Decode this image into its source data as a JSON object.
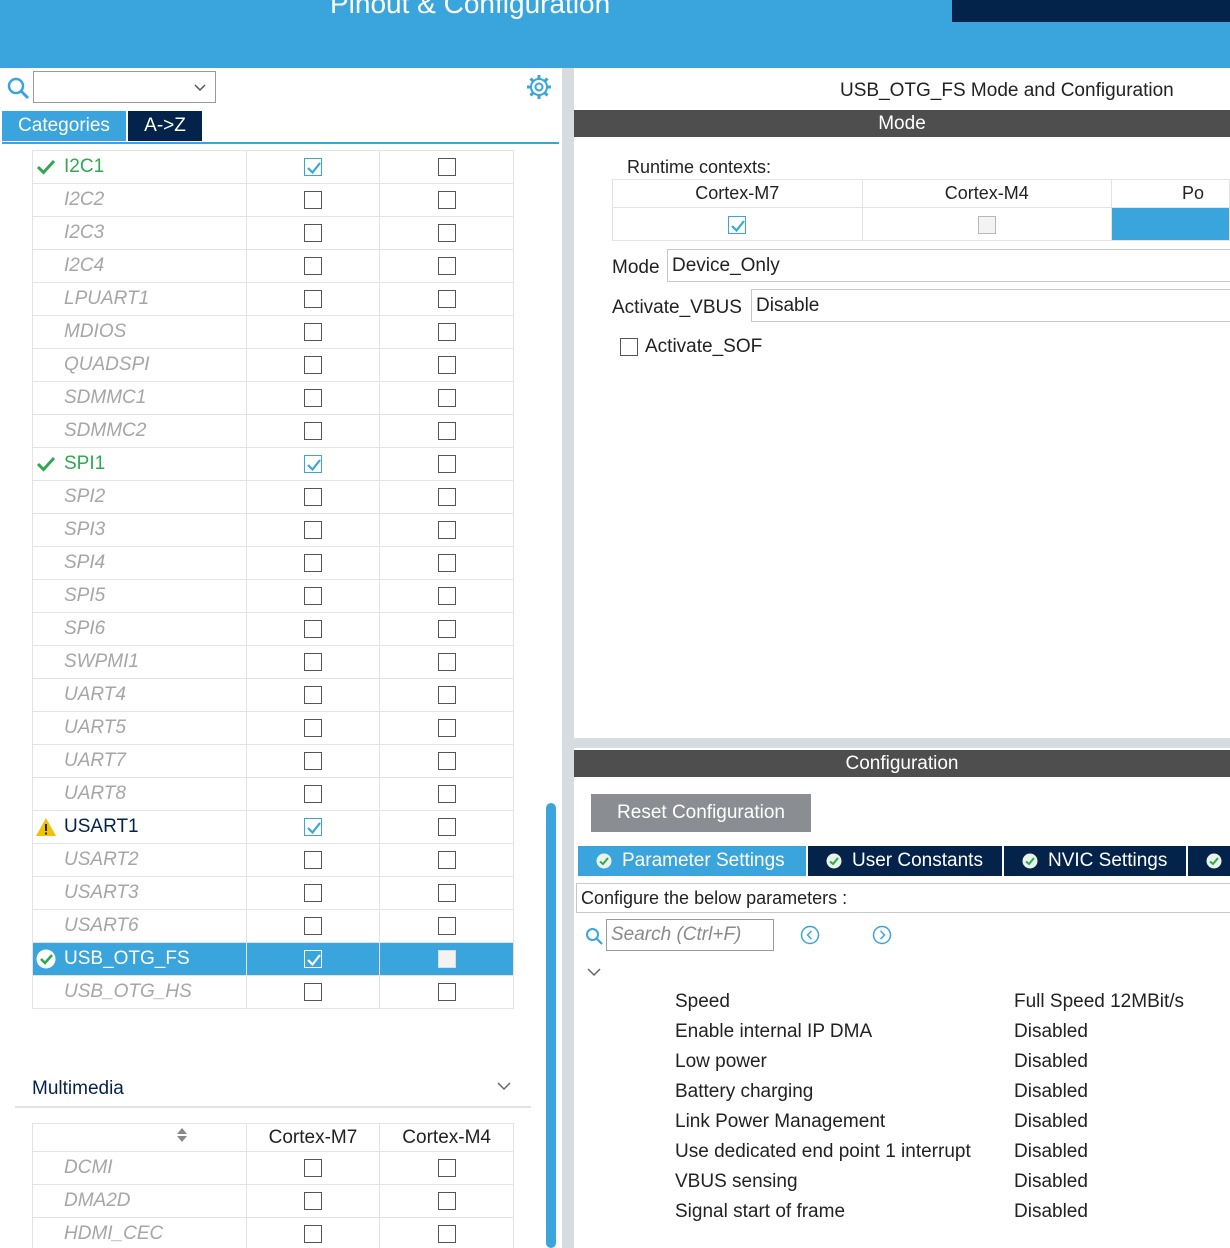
{
  "header": {
    "title": "Pinout & Configuration"
  },
  "left": {
    "tabs": [
      "Categories",
      "A->Z"
    ],
    "peripherals": [
      {
        "name": "I2C1",
        "state": "enabled",
        "m7": true,
        "m4": false
      },
      {
        "name": "I2C2",
        "state": "disabled",
        "m7": false,
        "m4": false
      },
      {
        "name": "I2C3",
        "state": "disabled",
        "m7": false,
        "m4": false
      },
      {
        "name": "I2C4",
        "state": "disabled",
        "m7": false,
        "m4": false
      },
      {
        "name": "LPUART1",
        "state": "disabled",
        "m7": false,
        "m4": false
      },
      {
        "name": "MDIOS",
        "state": "disabled",
        "m7": false,
        "m4": false
      },
      {
        "name": "QUADSPI",
        "state": "disabled",
        "m7": false,
        "m4": false
      },
      {
        "name": "SDMMC1",
        "state": "disabled",
        "m7": false,
        "m4": false
      },
      {
        "name": "SDMMC2",
        "state": "disabled",
        "m7": false,
        "m4": false
      },
      {
        "name": "SPI1",
        "state": "enabled",
        "m7": true,
        "m4": false
      },
      {
        "name": "SPI2",
        "state": "disabled",
        "m7": false,
        "m4": false
      },
      {
        "name": "SPI3",
        "state": "disabled",
        "m7": false,
        "m4": false
      },
      {
        "name": "SPI4",
        "state": "disabled",
        "m7": false,
        "m4": false
      },
      {
        "name": "SPI5",
        "state": "disabled",
        "m7": false,
        "m4": false
      },
      {
        "name": "SPI6",
        "state": "disabled",
        "m7": false,
        "m4": false
      },
      {
        "name": "SWPMI1",
        "state": "disabled",
        "m7": false,
        "m4": false
      },
      {
        "name": "UART4",
        "state": "disabled",
        "m7": false,
        "m4": false
      },
      {
        "name": "UART5",
        "state": "disabled",
        "m7": false,
        "m4": false
      },
      {
        "name": "UART7",
        "state": "disabled",
        "m7": false,
        "m4": false
      },
      {
        "name": "UART8",
        "state": "disabled",
        "m7": false,
        "m4": false
      },
      {
        "name": "USART1",
        "state": "warning",
        "m7": true,
        "m4": false
      },
      {
        "name": "USART2",
        "state": "disabled",
        "m7": false,
        "m4": false
      },
      {
        "name": "USART3",
        "state": "disabled",
        "m7": false,
        "m4": false
      },
      {
        "name": "USART6",
        "state": "disabled",
        "m7": false,
        "m4": false
      },
      {
        "name": "USB_OTG_FS",
        "state": "selected",
        "m7": true,
        "m4": false
      },
      {
        "name": "USB_OTG_HS",
        "state": "disabled",
        "m7": false,
        "m4": false
      }
    ],
    "multimedia": {
      "title": "Multimedia",
      "columns": [
        "Cortex-M7",
        "Cortex-M4"
      ],
      "items": [
        {
          "name": "DCMI",
          "m7": false,
          "m4": false
        },
        {
          "name": "DMA2D",
          "m7": false,
          "m4": false
        },
        {
          "name": "HDMI_CEC",
          "m7": false,
          "m4": false
        }
      ]
    }
  },
  "right": {
    "title": "USB_OTG_FS Mode and Configuration",
    "mode_bar": "Mode",
    "runtime_label": "Runtime contexts:",
    "runtime_columns": [
      "Cortex-M7",
      "Cortex-M4",
      "Po"
    ],
    "mode_label": "Mode",
    "mode_value": "Device_Only",
    "vbus_label": "Activate_VBUS",
    "vbus_value": "Disable",
    "sof_label": "Activate_SOF",
    "config_bar": "Configuration",
    "reset_button": "Reset Configuration",
    "config_tabs": [
      "Parameter Settings",
      "User Constants",
      "NVIC Settings"
    ],
    "configure_label": "Configure the below parameters :",
    "search_placeholder": "Search (Ctrl+F)",
    "parameters": [
      {
        "name": "Speed",
        "value": "Full Speed 12MBit/s"
      },
      {
        "name": "Enable internal IP DMA",
        "value": "Disabled"
      },
      {
        "name": "Low power",
        "value": "Disabled"
      },
      {
        "name": "Battery charging",
        "value": "Disabled"
      },
      {
        "name": "Link Power Management",
        "value": "Disabled"
      },
      {
        "name": "Use dedicated end point 1 interrupt",
        "value": "Disabled"
      },
      {
        "name": "VBUS sensing",
        "value": "Disabled"
      },
      {
        "name": "Signal start of frame",
        "value": "Disabled"
      }
    ]
  },
  "colors": {
    "accent": "#3aa5dc",
    "navy": "#03234b",
    "ok_green": "#2fa84f",
    "warning_yellow": "#f2c200"
  }
}
